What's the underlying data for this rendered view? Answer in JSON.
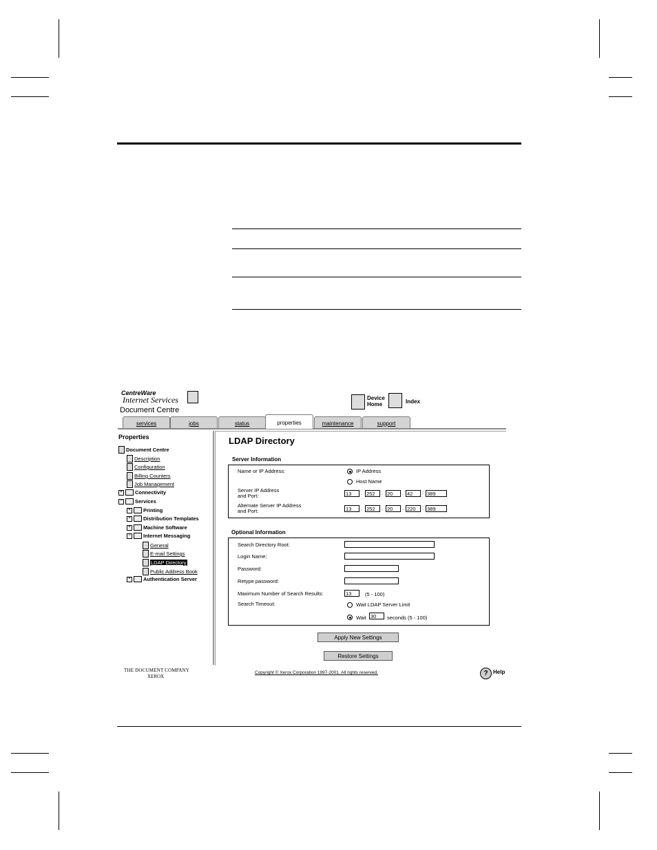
{
  "header": {
    "brand_line1": "CentreWare",
    "brand_line2": "Internet Services",
    "device_name": "Document Centre",
    "device_home_line1": "Device",
    "device_home_line2": "Home",
    "index_label": "Index"
  },
  "tabs": [
    {
      "label": "services",
      "active": false
    },
    {
      "label": "jobs",
      "active": false
    },
    {
      "label": "status",
      "active": false
    },
    {
      "label": "properties",
      "active": true
    },
    {
      "label": "maintenance",
      "active": false
    },
    {
      "label": "support",
      "active": false
    }
  ],
  "tree": {
    "title": "Properties",
    "root": "Document Centre",
    "items": [
      {
        "label": "Description"
      },
      {
        "label": "Configuration"
      },
      {
        "label": "Billing Counters"
      },
      {
        "label": "Job Management"
      },
      {
        "label": "Connectivity"
      },
      {
        "label": "Services"
      },
      {
        "label": "Printing"
      },
      {
        "label": "Distribution Templates"
      },
      {
        "label": "Machine Software"
      },
      {
        "label": "Internet Messaging"
      },
      {
        "label": "General"
      },
      {
        "label": "E-mail Settings"
      },
      {
        "label": "LDAP Directory"
      },
      {
        "label": "Public Address Book"
      },
      {
        "label": "Authentication Server"
      }
    ],
    "expand_plus": "+",
    "expand_minus": "−"
  },
  "main": {
    "title": "LDAP Directory",
    "server_section": {
      "title": "Server Information",
      "name_or_ip_label": "Name or IP Address:",
      "ip_address_option": "IP Address",
      "host_name_option": "Host Name",
      "server_ip_label1": "Server IP Address",
      "server_ip_label2": "and Port:",
      "server_ip": [
        "13",
        "252",
        "20",
        "42"
      ],
      "server_port": "389",
      "alt_ip_label1": "Alternate Server IP Address",
      "alt_ip_label2": "and Port:",
      "alt_ip": [
        "13",
        "252",
        "20",
        "220"
      ],
      "alt_port": "389",
      "dot": ".",
      "colon": ":"
    },
    "optional_section": {
      "title": "Optional Information",
      "search_root_label": "Search Directory Root:",
      "login_name_label": "Login Name:",
      "password_label": "Password:",
      "retype_password_label": "Retype password:",
      "max_results_label": "Maximum Number of Search Results:",
      "max_results_value": "13",
      "max_results_range": "(5 - 100)",
      "timeout_label": "Search Timeout:",
      "wait_limit_option": "Wait LDAP Server Limit",
      "wait_option": "Wait",
      "wait_value": "30",
      "wait_suffix": "seconds (5 - 100)"
    },
    "apply_button": "Apply New Settings",
    "restore_button": "Restore Settings"
  },
  "footer": {
    "company_line1": "THE DOCUMENT COMPANY",
    "company_line2": "XEROX",
    "copyright": "Copyright © Xerox Corporation 1997-2001. All rights reserved.",
    "help": "Help",
    "help_glyph": "?"
  }
}
